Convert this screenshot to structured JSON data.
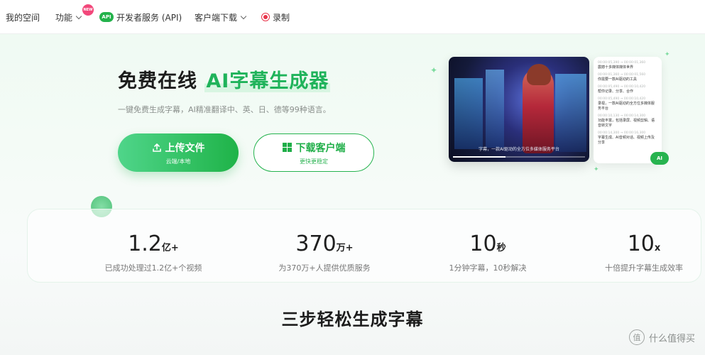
{
  "nav": {
    "items": [
      {
        "label": "我的空间"
      },
      {
        "label": "功能"
      },
      {
        "label": "开发者服务 (API)"
      },
      {
        "label": "客户端下载"
      },
      {
        "label": "录制"
      }
    ],
    "new_badge": "NEW",
    "api_pill": "API"
  },
  "hero": {
    "title_prefix": "免费在线",
    "title_highlight": "AI字幕生成器",
    "subtitle": "一键免费生成字幕，AI精准翻译中、英、日、德等99种语言。",
    "upload_label": "上传文件",
    "upload_sub": "云端/本地",
    "download_label": "下载客户端",
    "download_sub": "更快更稳定"
  },
  "preview": {
    "caption": "字幕，一款AI驱动的全方位多媒体服务平台",
    "subtitles": [
      {
        "time": "00:00:05,390 → 00:00:01,360",
        "text": "震撼十多媒体媒体世界"
      },
      {
        "time": "00:00:01,360 → 00:00:01,560",
        "text": "你需要一款AI驱动的工具"
      },
      {
        "time": "00:00:05,490 → 00:00:10,420",
        "text": "帮你记录、分享、合作"
      },
      {
        "time": "00:00:05,490 → 00:00:10,420",
        "text": "录视，一款AI驱动的全方位多媒体服务平台"
      },
      {
        "time": "00:00:10,130 → 00:00:14,300",
        "text": "功能丰富，包括录屏、视频剪辑、语音转文字"
      },
      {
        "time": "00:00:14,300 → 00:00:16,300",
        "text": "字幕生成、AI音频对话、视频上传及分享"
      }
    ],
    "ai_badge": "AI"
  },
  "stats": [
    {
      "number": "1.2",
      "unit": "亿+",
      "desc": "已成功处理过1.2亿+个视频"
    },
    {
      "number": "370",
      "unit": "万+",
      "desc": "为370万+人提供优质服务"
    },
    {
      "number": "10",
      "unit": "秒",
      "desc": "1分钟字幕，10秒解决"
    },
    {
      "number": "10",
      "unit": "x",
      "desc": "十倍提升字幕生成效率"
    }
  ],
  "section_title": "三步轻松生成字幕",
  "watermark": {
    "logo": "值",
    "text": "什么值得买"
  }
}
